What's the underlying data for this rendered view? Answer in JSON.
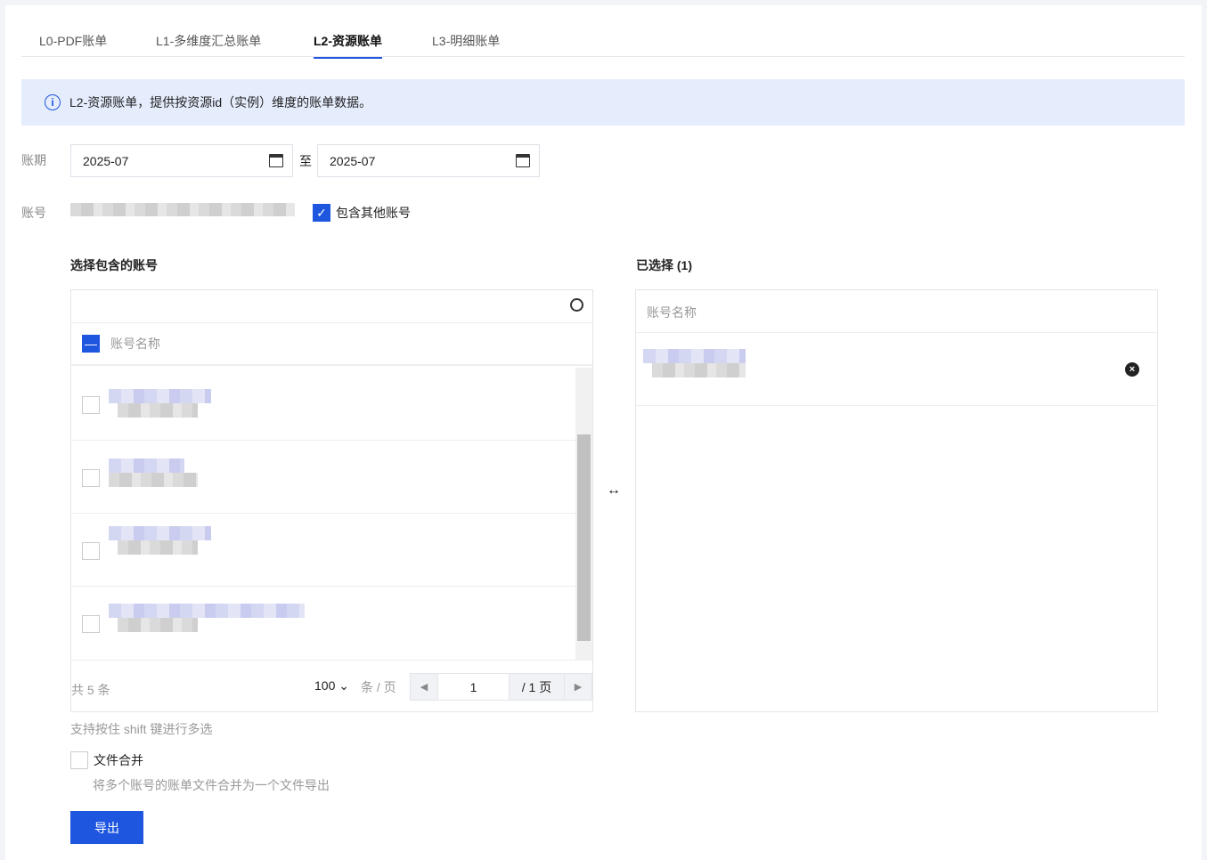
{
  "tabs": [
    {
      "label": "L0-PDF账单"
    },
    {
      "label": "L1-多维度汇总账单"
    },
    {
      "label": "L2-资源账单",
      "active": true
    },
    {
      "label": "L3-明细账单"
    }
  ],
  "banner": {
    "icon": "info-icon",
    "text": "L2-资源账单，提供按资源id（实例）维度的账单数据。"
  },
  "period": {
    "label": "账期",
    "start": "2025-07",
    "separator": "至",
    "end": "2025-07"
  },
  "account": {
    "label": "账号",
    "include_other_label": "包含其他账号",
    "include_other_checked": true
  },
  "left_panel": {
    "title": "选择包含的账号",
    "column": "账号名称",
    "search_placeholder": "",
    "total": "共 5 条",
    "page_size": "100",
    "per_page_label": "条 / 页",
    "page": "1",
    "page_total": "/ 1 页"
  },
  "right_panel": {
    "title": "已选择 (1)",
    "column": "账号名称"
  },
  "hint": "支持按住 shift 键进行多选",
  "merge": {
    "label": "文件合并",
    "checked": false,
    "desc": "将多个账号的账单文件合并为一个文件导出"
  },
  "export_label": "导出",
  "colors": {
    "accent": "#1e56e0",
    "banner": "#e5edfd"
  }
}
